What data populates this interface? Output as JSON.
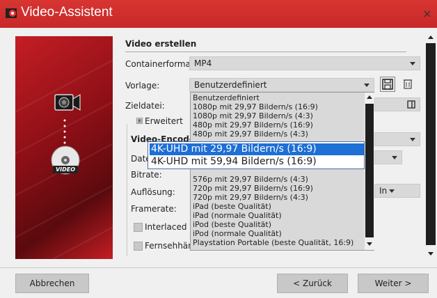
{
  "window": {
    "title": "Video-Assistent",
    "close_glyph": "×"
  },
  "side_panel": {
    "video_label": "VIDEO"
  },
  "section": {
    "title": "Video erstellen"
  },
  "fields": {
    "container_label": "Containerformat:",
    "container_value": "MP4",
    "template_label": "Vorlage:",
    "template_value": "Benutzerdefiniert",
    "target_label": "Zieldatei:",
    "advanced_toggle": "⊞",
    "advanced_label": "Erweitert",
    "encoder_label": "Video-Encoder",
    "file_label": "Date",
    "bitrate_label": "Bitrate:",
    "resolution_label": "Auflösung:",
    "resolution_unit": "In",
    "framerate_label": "Framerate:",
    "interlaced_label": "Interlaced",
    "tv_label": "Fernsehhände"
  },
  "dropdown_items": [
    "Benutzerdefiniert",
    "1080p mit 29,97 Bildern/s (16:9)",
    "1080p mit 29,97 Bildern/s (4:3)",
    "480p mit 29,97 Bildern/s (16:9)",
    "480p mit 29,97 Bildern/s (4:3)",
    "",
    "",
    "",
    "576p mit 29,97 Bildern/s (4:3)",
    "720p mit 29,97 Bildern/s (16:9)",
    "720p mit 29,97 Bildern/s (4:3)",
    "iPad (beste Qualität)",
    "iPad (normale Qualität)",
    "iPod (beste Qualität)",
    "iPod (normale Qualität)",
    "Playstation Portable (beste Qualität, 16:9)"
  ],
  "popup": {
    "selected": "4K-UHD mit 29,97 Bildern/s (16:9)",
    "other": "4K-UHD mit 59,94 Bildern/s (16:9)"
  },
  "footer": {
    "cancel": "Abbrechen",
    "back": "< Zurück",
    "next": "Weiter >"
  },
  "colors": {
    "accent": "#c9282a",
    "selection": "#1e6fd6"
  }
}
